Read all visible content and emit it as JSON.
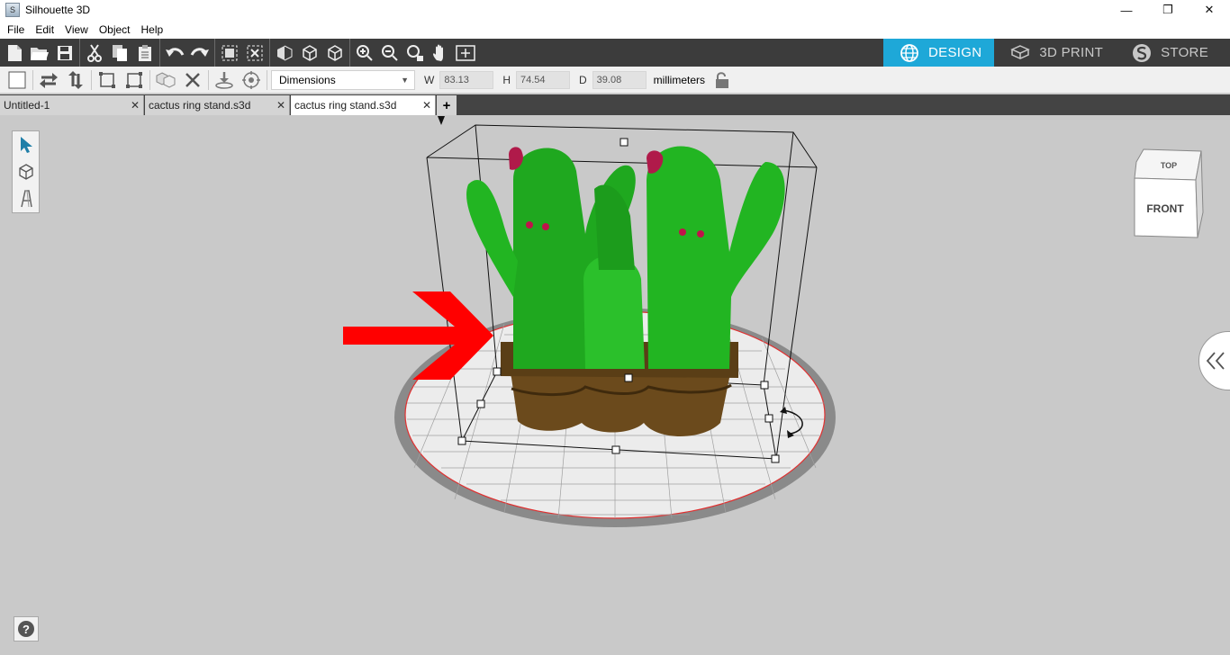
{
  "window": {
    "title": "Silhouette 3D",
    "minimize": "—",
    "maximize": "❐",
    "close": "✕"
  },
  "menu": [
    "File",
    "Edit",
    "View",
    "Object",
    "Help"
  ],
  "modes": [
    {
      "label": "DESIGN",
      "icon": "globe-icon",
      "active": true
    },
    {
      "label": "3D PRINT",
      "icon": "printer-bed-icon",
      "active": false
    },
    {
      "label": "STORE",
      "icon": "store-icon",
      "active": false
    }
  ],
  "toolbar": {
    "dimension_mode": "Dimensions",
    "w_label": "W",
    "w_value": "83.13",
    "h_label": "H",
    "h_value": "74.54",
    "d_label": "D",
    "d_value": "39.08",
    "units": "millimeters"
  },
  "tabs": [
    {
      "label": "Untitled-1",
      "active": false
    },
    {
      "label": "cactus ring stand.s3d",
      "active": false
    },
    {
      "label": "cactus ring stand.s3d",
      "active": true
    }
  ],
  "add_tab": "+",
  "view_cube": {
    "top": "TOP",
    "front": "FRONT"
  },
  "help_icon": "?",
  "colors": {
    "accent": "#1ea8d8",
    "toolbar_dark": "#3c3c3c",
    "cactus": "#22b522",
    "pot": "#6b4a1c",
    "arrow": "#ff0000"
  }
}
